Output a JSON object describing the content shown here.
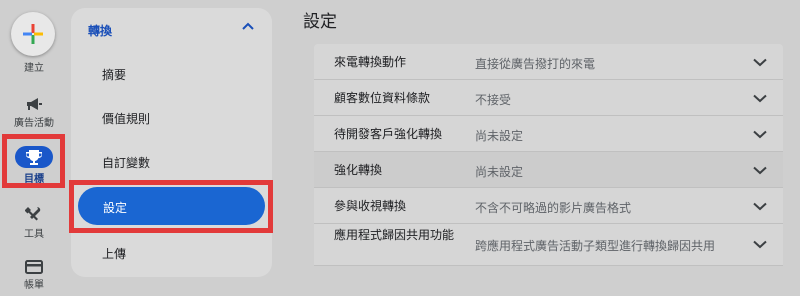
{
  "rail": {
    "create_label": "建立",
    "items": [
      {
        "label": "廣告活動",
        "icon": "megaphone-icon"
      },
      {
        "label": "目標",
        "icon": "trophy-icon"
      },
      {
        "label": "工具",
        "icon": "tools-icon"
      },
      {
        "label": "帳單",
        "icon": "credit-card-icon"
      }
    ]
  },
  "subnav": {
    "section_title": "轉換",
    "items": [
      "摘要",
      "價值規則",
      "自訂變數",
      "設定",
      "上傳"
    ],
    "active": "設定"
  },
  "main": {
    "title": "設定",
    "rows": [
      {
        "label": "來電轉換動作",
        "value": "直接從廣告撥打的來電"
      },
      {
        "label": "顧客數位資料條款",
        "value": "不接受"
      },
      {
        "label": "待開發客戶強化轉換",
        "value": "尚未設定"
      },
      {
        "label": "強化轉換",
        "value": "尚未設定"
      },
      {
        "label": "參與收視轉換",
        "value": "不含不可略過的影片廣告格式"
      },
      {
        "label": "應用程式歸因共用功能",
        "value": "跨應用程式廣告活動子類型進行轉換歸因共用"
      }
    ]
  },
  "colors": {
    "accent": "#1a66d2",
    "highlight": "#e23a3a",
    "background": "#cfcfcf"
  }
}
